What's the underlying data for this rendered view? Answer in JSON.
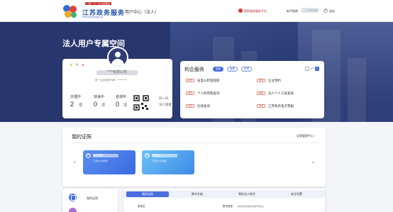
{
  "header": {
    "logo_tag": "一网·一门·一次 全省通办",
    "logo_cn": "江苏政务服务",
    "logo_en": "www.jszwfw.gov.cn",
    "user_center": "用户中心（法人）",
    "portal_link": "国家政务服务平台",
    "phone_label": "新手指南",
    "phone_value": "****9**97",
    "logout": "退出"
  },
  "banner": {
    "title": "法人用户专属空间"
  },
  "profile": {
    "name": "****有限公司",
    "credit_code": "统一社会信用代码：**********"
  },
  "stats": [
    {
      "label": "办理中",
      "value": "2",
      "unit": "项"
    },
    {
      "label": "快递中",
      "value": "0",
      "unit": "项"
    },
    {
      "label": "咨询中",
      "value": "0",
      "unit": "项"
    }
  ],
  "qr": {
    "line1": "扫一扫",
    "line2": "法人管家"
  },
  "services": {
    "title": "利企服务",
    "chips": [
      "全部",
      "高频",
      "查询"
    ],
    "pager": "1/7",
    "items": [
      {
        "tag": "事项",
        "name": "省直公积金提取"
      },
      {
        "tag": "事项",
        "name": "个人所得税查询"
      },
      {
        "tag": "事项",
        "name": "社保查询"
      },
      {
        "tag": "事项",
        "name": "企业预约"
      },
      {
        "tag": "事项",
        "name": "法人个人工具查询"
      },
      {
        "tag": "事项",
        "name": "江苏税务电子票据"
      }
    ]
  },
  "certs": {
    "title": "我的证照",
    "manage": "证照管理中心 ›",
    "items": [
      {
        "name": "营业执照",
        "sub": "江苏省人民政府"
      },
      {
        "name": "许可证",
        "sub": "江苏省人民政府"
      }
    ]
  },
  "bottom": {
    "side_label": "我的证照",
    "tabs": [
      "我的证照",
      "数字升级",
      "我的法人账号",
      "安全设置"
    ],
    "form_label1": "登录名",
    "form_label2": "账号类型",
    "form_note": "(请先登录获取您的账号信息)"
  }
}
